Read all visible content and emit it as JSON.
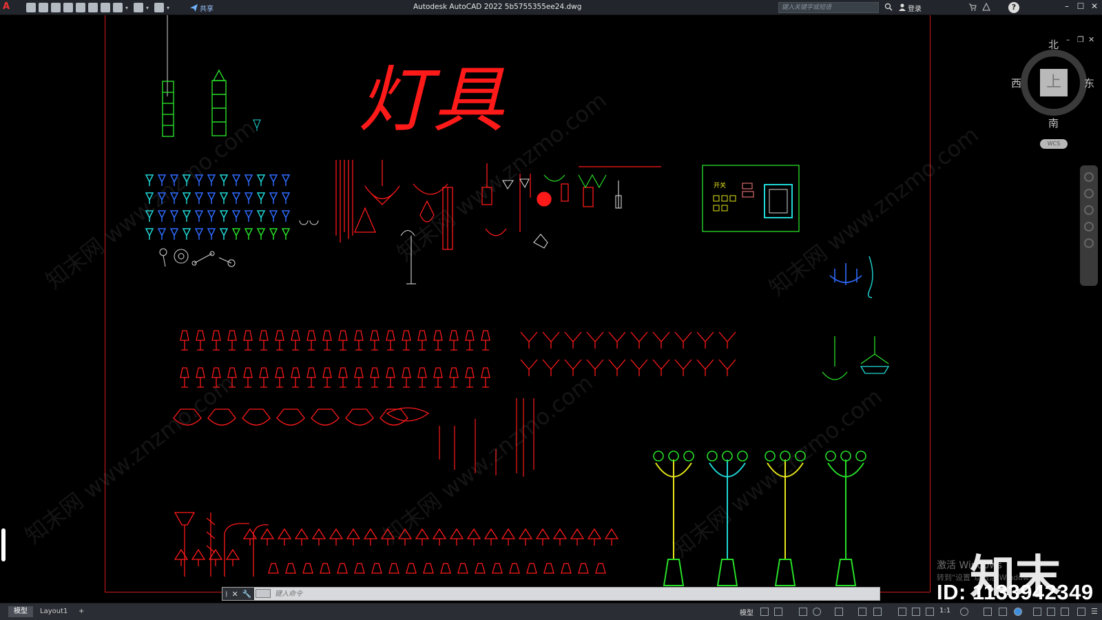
{
  "titlebar": {
    "logo": "A",
    "share_label": "共享",
    "window_title": "Autodesk AutoCAD 2022    5b5755355ee24.dwg",
    "search_placeholder": "键入关键字或短语",
    "login_label": "登录",
    "help_label": "?",
    "min_label": "–",
    "max_label": "☐",
    "close_label": "✕"
  },
  "drawing": {
    "title": "灯具",
    "watermark": "知末网 www.znzmo.com",
    "panel_label": "开关"
  },
  "viewcube": {
    "north": "北",
    "south": "南",
    "east": "东",
    "west": "西",
    "face": "上",
    "wcs": "WCS"
  },
  "command": {
    "placeholder": "键入命令"
  },
  "statusbar": {
    "tabs": [
      "模型",
      "Layout1",
      "+"
    ],
    "model_label": "模型",
    "scale_label": "1:1"
  },
  "overlay": {
    "activate_title": "激活 Windows",
    "activate_sub": "转到\"设置\"以激活 Windows。",
    "brand": "知末",
    "id_text": "ID: 1133942349"
  },
  "colors": {
    "red": "#ff1a1a",
    "green": "#28e028",
    "blue": "#2f6bff",
    "cyan": "#20d8d8",
    "yellow": "#e8e81a",
    "white": "#d8d8d8",
    "frame": "#d21b1b"
  }
}
